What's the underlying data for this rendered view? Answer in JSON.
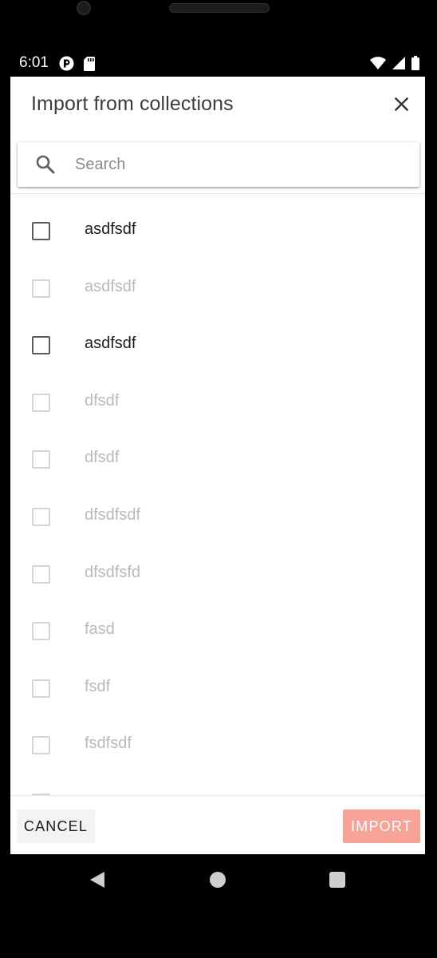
{
  "status_bar": {
    "time": "6:01",
    "left_icons": [
      "tracker-app-icon",
      "sd-card-icon"
    ],
    "right_icons": [
      "wifi-icon",
      "cell-signal-icon",
      "battery-icon"
    ]
  },
  "dialog": {
    "title": "Import from collections",
    "close_icon": "close-icon",
    "search": {
      "icon": "search-icon",
      "placeholder": "Search",
      "value": ""
    },
    "items": [
      {
        "label": "asdfsdf",
        "enabled": true,
        "checked": false
      },
      {
        "label": "asdfsdf",
        "enabled": false,
        "checked": false
      },
      {
        "label": "asdfsdf",
        "enabled": true,
        "checked": false
      },
      {
        "label": "dfsdf",
        "enabled": false,
        "checked": false
      },
      {
        "label": "dfsdf",
        "enabled": false,
        "checked": false
      },
      {
        "label": "dfsdfsdf",
        "enabled": false,
        "checked": false
      },
      {
        "label": "dfsdfsfd",
        "enabled": false,
        "checked": false
      },
      {
        "label": "fasd",
        "enabled": false,
        "checked": false
      },
      {
        "label": "fsdf",
        "enabled": false,
        "checked": false
      },
      {
        "label": "fsdfsdf",
        "enabled": false,
        "checked": false
      }
    ],
    "cancel_label": "CANCEL",
    "import_label": "IMPORT"
  },
  "colors": {
    "import_button": "#f8a398",
    "dialog_background": "#ffffff",
    "screen_background": "#000000"
  },
  "nav_bar": {
    "icons": [
      "back-icon",
      "home-icon",
      "recents-icon"
    ]
  }
}
